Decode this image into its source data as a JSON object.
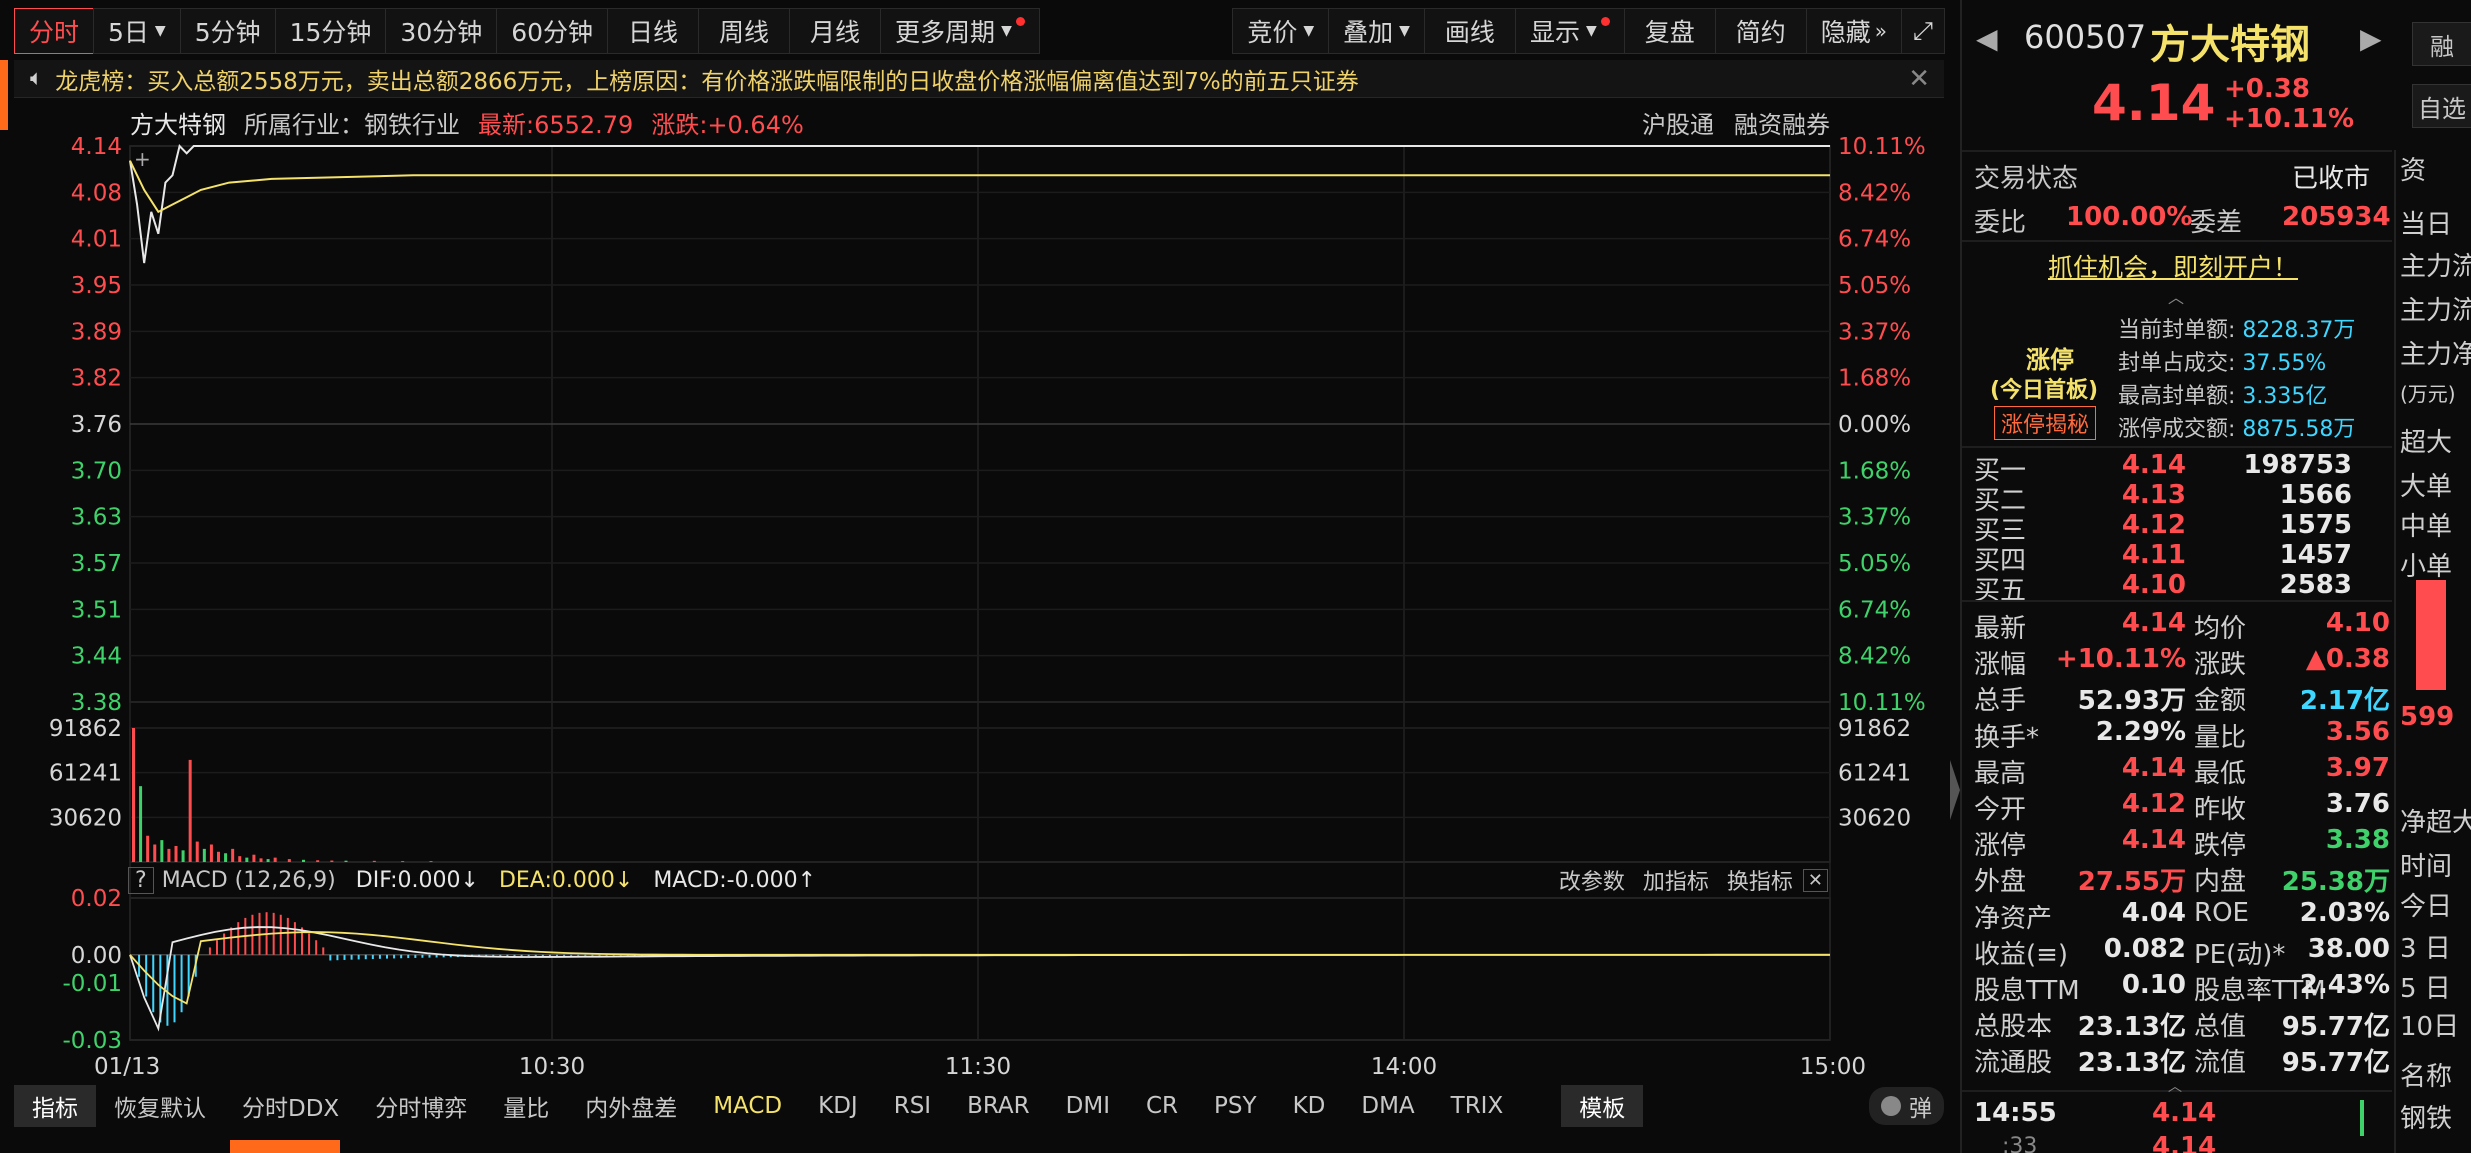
{
  "toolbar": {
    "tabs": [
      "分时",
      "5日",
      "5分钟",
      "15分钟",
      "30分钟",
      "60分钟",
      "日线",
      "周线",
      "月线",
      "更多周期"
    ],
    "right_buttons": [
      "竞价",
      "叠加",
      "画线",
      "显示",
      "复盘",
      "简约",
      "隐藏"
    ],
    "expand_icon": "expand-icon"
  },
  "lhb": {
    "icon": "speaker-icon",
    "text": "龙虎榜：买入总额2558万元，卖出总额2866万元，上榜原因：有价格涨跌幅限制的日收盘价格涨幅偏离值达到7%的前五只证券",
    "close_icon": "close-icon"
  },
  "chart_header": {
    "name": "方大特钢",
    "industry": "所属行业：钢铁行业",
    "latest": "最新:6552.79",
    "change": "涨跌:+0.64%",
    "right_links": [
      "沪股通",
      "融资融券"
    ]
  },
  "chart_data": [
    {
      "type": "line",
      "title": "分时",
      "x_ticks": [
        "01/13",
        "10:30",
        "11:30",
        "14:00",
        "15:00"
      ],
      "y_left_ticks": [
        "4.14",
        "4.08",
        "4.01",
        "3.95",
        "3.89",
        "3.82",
        "3.76",
        "3.70",
        "3.63",
        "3.57",
        "3.51",
        "3.44",
        "3.38"
      ],
      "y_right_ticks": [
        "10.11%",
        "8.42%",
        "6.74%",
        "5.05%",
        "3.37%",
        "1.68%",
        "0.00%",
        "1.68%",
        "3.37%",
        "5.05%",
        "6.74%",
        "8.42%",
        "10.11%"
      ],
      "ylim": [
        3.38,
        4.14
      ],
      "series": [
        {
          "name": "price",
          "color": "#e8e8e8",
          "x": [
            0,
            1,
            2,
            3,
            4,
            5,
            6,
            7,
            8,
            9,
            10,
            12,
            240
          ],
          "values": [
            4.12,
            4.06,
            3.98,
            4.05,
            4.02,
            4.09,
            4.1,
            4.14,
            4.13,
            4.14,
            4.14,
            4.14,
            4.14
          ]
        },
        {
          "name": "avg",
          "color": "#f5e26b",
          "x": [
            0,
            2,
            4,
            6,
            8,
            10,
            14,
            20,
            40,
            120,
            240
          ],
          "values": [
            4.12,
            4.08,
            4.05,
            4.06,
            4.07,
            4.08,
            4.09,
            4.095,
            4.1,
            4.1,
            4.1
          ]
        }
      ]
    },
    {
      "type": "bar",
      "title": "volume",
      "y_ticks": [
        "91862",
        "61241",
        "30620"
      ],
      "ylim": [
        0,
        91862
      ],
      "x": [
        0,
        1,
        2,
        3,
        4,
        5,
        6,
        7,
        8,
        9,
        10,
        11,
        12,
        13,
        14,
        15,
        16,
        17,
        18,
        19,
        20,
        22,
        24,
        26,
        28,
        30,
        34,
        38,
        42
      ],
      "values": [
        91862,
        52000,
        18000,
        12000,
        15000,
        9000,
        11000,
        8000,
        70000,
        14000,
        9000,
        12000,
        7000,
        6000,
        9000,
        4000,
        3000,
        5000,
        2500,
        2000,
        3000,
        2000,
        1500,
        1200,
        1000,
        900,
        800,
        600,
        500
      ]
    },
    {
      "type": "line",
      "title": "MACD (12,26,9)",
      "legend": [
        "DIF:0.000↓",
        "DEA:0.000↓",
        "MACD:-0.000↑"
      ],
      "y_ticks": [
        "0.02",
        "0.00",
        "-0.01",
        "-0.03"
      ],
      "ylim": [
        -0.03,
        0.02
      ]
    }
  ],
  "macd_controls": [
    "改参数",
    "加指标",
    "换指标"
  ],
  "ind_tabs": [
    "指标",
    "恢复默认",
    "分时DDX",
    "分时博弈",
    "量比",
    "内外盘差",
    "MACD",
    "KDJ",
    "RSI",
    "BRAR",
    "DMI",
    "CR",
    "PSY",
    "KD",
    "DMA",
    "TRIX",
    "模板"
  ],
  "pop_toggle": "弹",
  "right_panel": {
    "code": "600507",
    "name": "方大特钢",
    "price": "4.14",
    "change": "+0.38",
    "change_pct": "+10.11%",
    "side_btn1": "融",
    "side_btn2": "自选",
    "trade_status_label": "交易状态",
    "trade_status": "已收市",
    "weibi_label": "委比",
    "weibi": "100.00%",
    "weicha_label": "委差",
    "weicha": "205934",
    "open_account": "抓住机会，即刻开户！",
    "limit_label": "涨停",
    "limit_sub": "(今日首板)",
    "limit_btn": "涨停揭秘",
    "limit_stats": [
      {
        "label": "当前封单额:",
        "value": "8228.37万"
      },
      {
        "label": "封单占成交:",
        "value": "37.55%"
      },
      {
        "label": "最高封单额:",
        "value": "3.335亿"
      },
      {
        "label": "涨停成交额:",
        "value": "8875.58万"
      }
    ],
    "buy_levels": [
      {
        "label": "买一",
        "price": "4.14",
        "vol": "198753"
      },
      {
        "label": "买二",
        "price": "4.13",
        "vol": "1566"
      },
      {
        "label": "买三",
        "price": "4.12",
        "vol": "1575"
      },
      {
        "label": "买四",
        "price": "4.11",
        "vol": "1457"
      },
      {
        "label": "买五",
        "price": "4.10",
        "vol": "2583"
      }
    ],
    "stats": [
      {
        "l1": "最新",
        "v1": "4.14",
        "c1": "red",
        "l2": "均价",
        "v2": "4.10",
        "c2": "red"
      },
      {
        "l1": "涨幅",
        "v1": "+10.11%",
        "c1": "red",
        "l2": "涨跌",
        "v2": "▲0.38",
        "c2": "red"
      },
      {
        "l1": "总手",
        "v1": "52.93万",
        "c1": "white",
        "l2": "金额",
        "v2": "2.17亿",
        "c2": "cyan"
      },
      {
        "l1": "换手*",
        "v1": "2.29%",
        "c1": "white",
        "l2": "量比",
        "v2": "3.56",
        "c2": "red"
      },
      {
        "l1": "最高",
        "v1": "4.14",
        "c1": "red",
        "l2": "最低",
        "v2": "3.97",
        "c2": "red"
      },
      {
        "l1": "今开",
        "v1": "4.12",
        "c1": "red",
        "l2": "昨收",
        "v2": "3.76",
        "c2": "white"
      },
      {
        "l1": "涨停",
        "v1": "4.14",
        "c1": "red",
        "l2": "跌停",
        "v2": "3.38",
        "c2": "green"
      },
      {
        "l1": "外盘",
        "v1": "27.55万",
        "c1": "red",
        "l2": "内盘",
        "v2": "25.38万",
        "c2": "green"
      },
      {
        "l1": "净资产",
        "v1": "4.04",
        "c1": "white",
        "l2": "ROE",
        "v2": "2.03%",
        "c2": "white"
      },
      {
        "l1": "收益(≡)",
        "v1": "0.082",
        "c1": "white",
        "l2": "PE(动)*",
        "v2": "38.00",
        "c2": "white"
      },
      {
        "l1": "股息TTM",
        "v1": "0.10",
        "c1": "white",
        "l2": "股息率TTM",
        "v2": "2.43%",
        "c2": "white"
      },
      {
        "l1": "总股本",
        "v1": "23.13亿",
        "c1": "white",
        "l2": "总值",
        "v2": "95.77亿",
        "c2": "white"
      },
      {
        "l1": "流通股",
        "v1": "23.13亿",
        "c1": "white",
        "l2": "流值",
        "v2": "95.77亿",
        "c2": "white"
      }
    ],
    "tick_time": "14:55",
    "tick_price": "4.14",
    "tick_time2": ":33",
    "tick_price2": "4.14",
    "edge_labels": [
      "资",
      "当日",
      "主力流",
      "主力流",
      "主力净",
      "(万元)",
      "超大",
      "大单",
      "中单",
      "小单",
      "599",
      "净超大",
      "时间",
      "今日",
      "3 日",
      "5 日",
      "10日",
      "名称",
      "钢铁"
    ]
  }
}
